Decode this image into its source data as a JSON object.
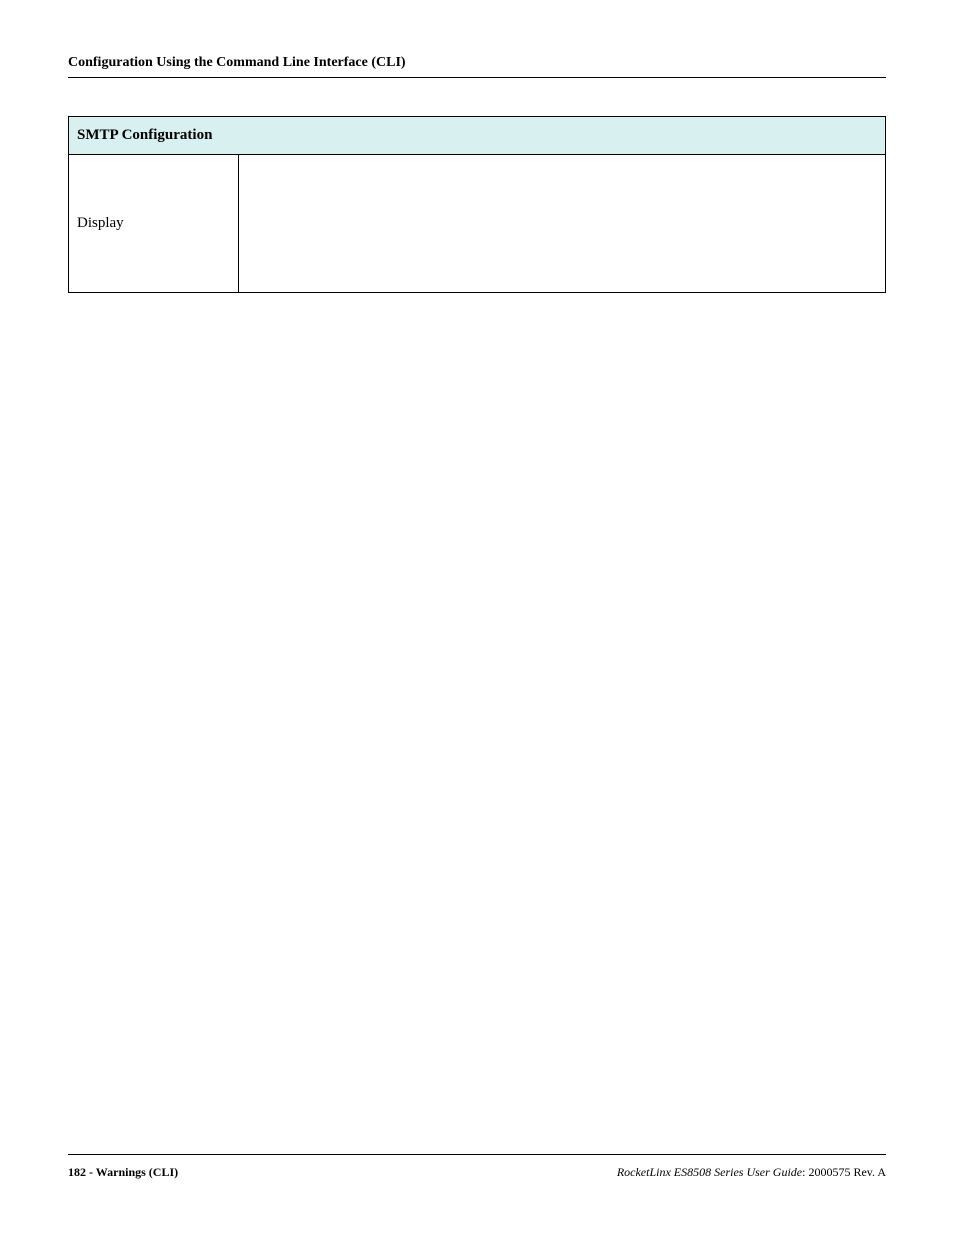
{
  "header": {
    "title": "Configuration Using the Command Line Interface (CLI)"
  },
  "table": {
    "heading": "SMTP Configuration",
    "row_label": "Display",
    "row_content": ""
  },
  "footer": {
    "page_label": "182 - Warnings (CLI)",
    "doc_title": "RocketLinx ES8508 Series  User Guide",
    "doc_revision": ": 2000575 Rev. A"
  }
}
